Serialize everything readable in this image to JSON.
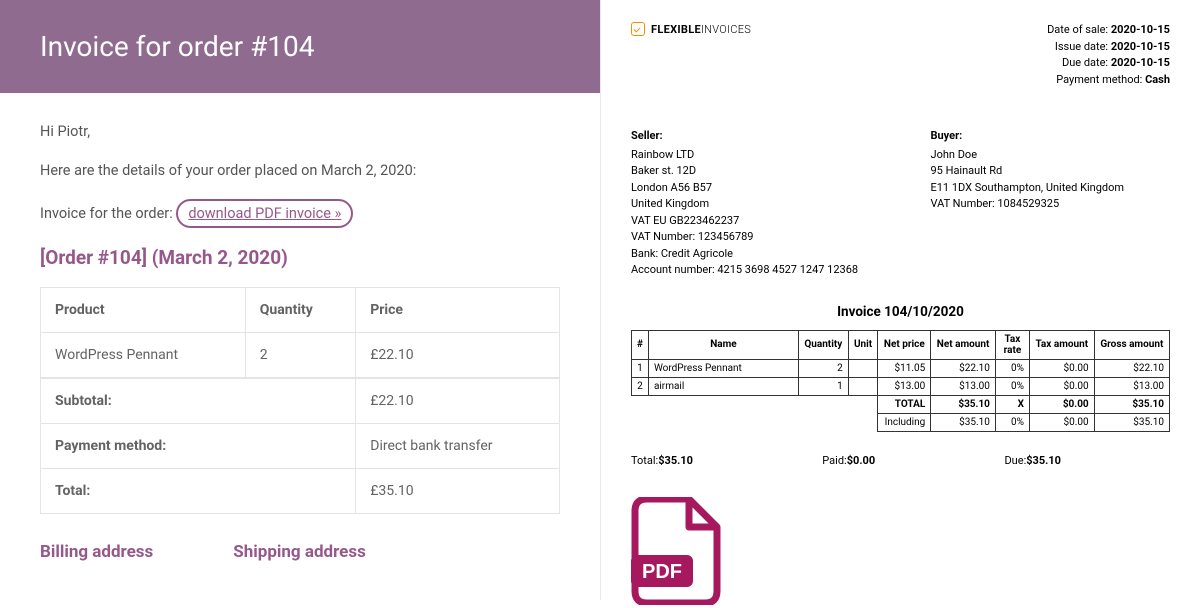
{
  "email": {
    "banner_title": "Invoice for order #104",
    "greeting": "Hi Piotr,",
    "details_line": "Here are the details of your order placed on March 2, 2020:",
    "invoice_for_order_prefix": "Invoice for the order: ",
    "download_link": "download PDF invoice »",
    "order_heading": "[Order #104] (March 2, 2020)",
    "table": {
      "headers": {
        "product": "Product",
        "quantity": "Quantity",
        "price": "Price"
      },
      "row1": {
        "product": "WordPress Pennant",
        "quantity": "2",
        "price": "£22.10"
      },
      "subtotal_label": "Subtotal:",
      "subtotal_value": "£22.10",
      "payment_label": "Payment method:",
      "payment_value": "Direct bank transfer",
      "total_label": "Total:",
      "total_value": "£35.10"
    },
    "billing_heading": "Billing address",
    "shipping_heading": "Shipping address"
  },
  "invoice": {
    "brand_strong": "FLEXIBLE",
    "brand_rest": "INVOICES",
    "meta": {
      "sale_label": "Date of sale: ",
      "sale_value": "2020-10-15",
      "issue_label": "Issue date: ",
      "issue_value": "2020-10-15",
      "due_label": "Due date: ",
      "due_value": "2020-10-15",
      "payment_label": "Payment method: ",
      "payment_value": "Cash"
    },
    "seller": {
      "title": "Seller:",
      "name": "Rainbow LTD",
      "line1": "Baker st. 12D",
      "line2": "London A56 B57",
      "line3": "United Kingdom",
      "vat_eu": "VAT EU GB223462237",
      "vat_no": "VAT Number: 123456789",
      "bank": "Bank: Credit Agricole",
      "account": "Account number: 4215 3698 4527 1247 12368"
    },
    "buyer": {
      "title": "Buyer:",
      "name": "John Doe",
      "line1": "95 Hainault Rd",
      "line2": "E11 1DX Southampton, United Kingdom",
      "vat_no": "VAT Number: 1084529325"
    },
    "title": "Invoice 104/10/2020",
    "headers": {
      "no": "#",
      "name": "Name",
      "qty": "Quantity",
      "unit": "Unit",
      "net_price": "Net price",
      "net_amount": "Net amount",
      "tax_rate": "Tax rate",
      "tax_amount": "Tax amount",
      "gross": "Gross amount"
    },
    "rows": {
      "r1": {
        "no": "1",
        "name": "WordPress Pennant",
        "qty": "2",
        "unit": "",
        "net_price": "$11.05",
        "net_amount": "$22.10",
        "tax_rate": "0%",
        "tax_amount": "$0.00",
        "gross": "$22.10"
      },
      "r2": {
        "no": "2",
        "name": "airmail",
        "qty": "1",
        "unit": "",
        "net_price": "$13.00",
        "net_amount": "$13.00",
        "tax_rate": "0%",
        "tax_amount": "$0.00",
        "gross": "$13.00"
      }
    },
    "sum": {
      "total_label": "TOTAL",
      "total_net": "$35.10",
      "total_tax_rate": "X",
      "total_tax": "$0.00",
      "total_gross": "$35.10",
      "incl_label": "Including",
      "incl_net": "$35.10",
      "incl_rate": "0%",
      "incl_tax": "$0.00",
      "incl_gross": "$35.10"
    },
    "footer": {
      "total_label": "Total:",
      "total_value": "$35.10",
      "paid_label": "Paid:",
      "paid_value": "$0.00",
      "due_label": "Due:",
      "due_value": "$35.10"
    },
    "pdf_label": "PDF"
  }
}
